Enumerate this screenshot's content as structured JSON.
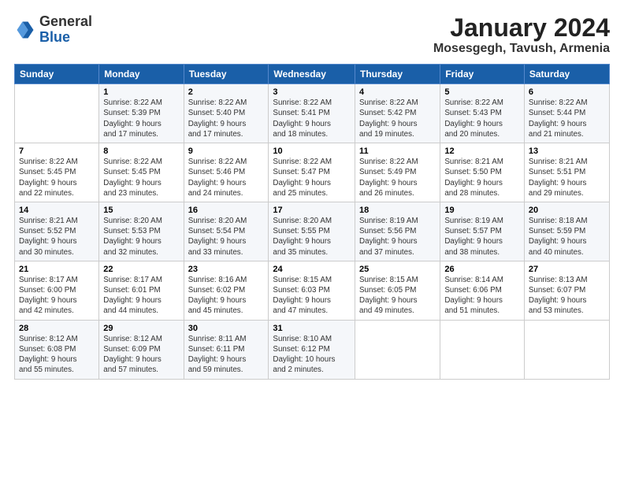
{
  "header": {
    "logo_general": "General",
    "logo_blue": "Blue",
    "title": "January 2024",
    "subtitle": "Mosesgegh, Tavush, Armenia"
  },
  "days_of_week": [
    "Sunday",
    "Monday",
    "Tuesday",
    "Wednesday",
    "Thursday",
    "Friday",
    "Saturday"
  ],
  "weeks": [
    [
      {
        "num": "",
        "info": ""
      },
      {
        "num": "1",
        "info": "Sunrise: 8:22 AM\nSunset: 5:39 PM\nDaylight: 9 hours\nand 17 minutes."
      },
      {
        "num": "2",
        "info": "Sunrise: 8:22 AM\nSunset: 5:40 PM\nDaylight: 9 hours\nand 17 minutes."
      },
      {
        "num": "3",
        "info": "Sunrise: 8:22 AM\nSunset: 5:41 PM\nDaylight: 9 hours\nand 18 minutes."
      },
      {
        "num": "4",
        "info": "Sunrise: 8:22 AM\nSunset: 5:42 PM\nDaylight: 9 hours\nand 19 minutes."
      },
      {
        "num": "5",
        "info": "Sunrise: 8:22 AM\nSunset: 5:43 PM\nDaylight: 9 hours\nand 20 minutes."
      },
      {
        "num": "6",
        "info": "Sunrise: 8:22 AM\nSunset: 5:44 PM\nDaylight: 9 hours\nand 21 minutes."
      }
    ],
    [
      {
        "num": "7",
        "info": "Sunrise: 8:22 AM\nSunset: 5:45 PM\nDaylight: 9 hours\nand 22 minutes."
      },
      {
        "num": "8",
        "info": "Sunrise: 8:22 AM\nSunset: 5:45 PM\nDaylight: 9 hours\nand 23 minutes."
      },
      {
        "num": "9",
        "info": "Sunrise: 8:22 AM\nSunset: 5:46 PM\nDaylight: 9 hours\nand 24 minutes."
      },
      {
        "num": "10",
        "info": "Sunrise: 8:22 AM\nSunset: 5:47 PM\nDaylight: 9 hours\nand 25 minutes."
      },
      {
        "num": "11",
        "info": "Sunrise: 8:22 AM\nSunset: 5:49 PM\nDaylight: 9 hours\nand 26 minutes."
      },
      {
        "num": "12",
        "info": "Sunrise: 8:21 AM\nSunset: 5:50 PM\nDaylight: 9 hours\nand 28 minutes."
      },
      {
        "num": "13",
        "info": "Sunrise: 8:21 AM\nSunset: 5:51 PM\nDaylight: 9 hours\nand 29 minutes."
      }
    ],
    [
      {
        "num": "14",
        "info": "Sunrise: 8:21 AM\nSunset: 5:52 PM\nDaylight: 9 hours\nand 30 minutes."
      },
      {
        "num": "15",
        "info": "Sunrise: 8:20 AM\nSunset: 5:53 PM\nDaylight: 9 hours\nand 32 minutes."
      },
      {
        "num": "16",
        "info": "Sunrise: 8:20 AM\nSunset: 5:54 PM\nDaylight: 9 hours\nand 33 minutes."
      },
      {
        "num": "17",
        "info": "Sunrise: 8:20 AM\nSunset: 5:55 PM\nDaylight: 9 hours\nand 35 minutes."
      },
      {
        "num": "18",
        "info": "Sunrise: 8:19 AM\nSunset: 5:56 PM\nDaylight: 9 hours\nand 37 minutes."
      },
      {
        "num": "19",
        "info": "Sunrise: 8:19 AM\nSunset: 5:57 PM\nDaylight: 9 hours\nand 38 minutes."
      },
      {
        "num": "20",
        "info": "Sunrise: 8:18 AM\nSunset: 5:59 PM\nDaylight: 9 hours\nand 40 minutes."
      }
    ],
    [
      {
        "num": "21",
        "info": "Sunrise: 8:17 AM\nSunset: 6:00 PM\nDaylight: 9 hours\nand 42 minutes."
      },
      {
        "num": "22",
        "info": "Sunrise: 8:17 AM\nSunset: 6:01 PM\nDaylight: 9 hours\nand 44 minutes."
      },
      {
        "num": "23",
        "info": "Sunrise: 8:16 AM\nSunset: 6:02 PM\nDaylight: 9 hours\nand 45 minutes."
      },
      {
        "num": "24",
        "info": "Sunrise: 8:15 AM\nSunset: 6:03 PM\nDaylight: 9 hours\nand 47 minutes."
      },
      {
        "num": "25",
        "info": "Sunrise: 8:15 AM\nSunset: 6:05 PM\nDaylight: 9 hours\nand 49 minutes."
      },
      {
        "num": "26",
        "info": "Sunrise: 8:14 AM\nSunset: 6:06 PM\nDaylight: 9 hours\nand 51 minutes."
      },
      {
        "num": "27",
        "info": "Sunrise: 8:13 AM\nSunset: 6:07 PM\nDaylight: 9 hours\nand 53 minutes."
      }
    ],
    [
      {
        "num": "28",
        "info": "Sunrise: 8:12 AM\nSunset: 6:08 PM\nDaylight: 9 hours\nand 55 minutes."
      },
      {
        "num": "29",
        "info": "Sunrise: 8:12 AM\nSunset: 6:09 PM\nDaylight: 9 hours\nand 57 minutes."
      },
      {
        "num": "30",
        "info": "Sunrise: 8:11 AM\nSunset: 6:11 PM\nDaylight: 9 hours\nand 59 minutes."
      },
      {
        "num": "31",
        "info": "Sunrise: 8:10 AM\nSunset: 6:12 PM\nDaylight: 10 hours\nand 2 minutes."
      },
      {
        "num": "",
        "info": ""
      },
      {
        "num": "",
        "info": ""
      },
      {
        "num": "",
        "info": ""
      }
    ]
  ]
}
